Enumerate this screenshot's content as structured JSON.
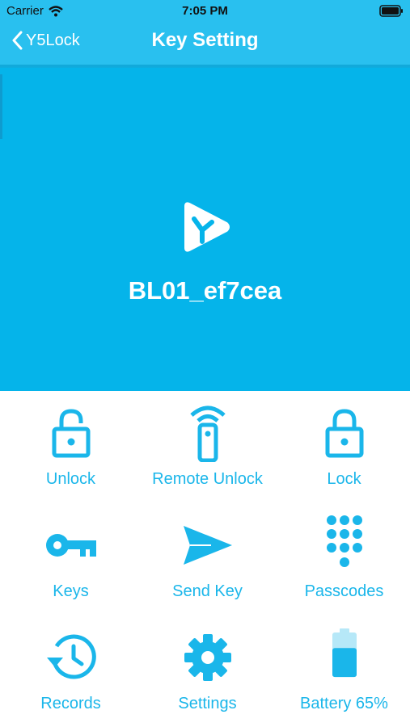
{
  "status_bar": {
    "carrier": "Carrier",
    "time": "7:05 PM"
  },
  "nav": {
    "back_label": "Y5Lock",
    "title": "Key Setting"
  },
  "device": {
    "name": "BL01_ef7cea"
  },
  "actions": [
    {
      "label": "Unlock",
      "icon": "unlock-icon"
    },
    {
      "label": "Remote Unlock",
      "icon": "remote-icon"
    },
    {
      "label": "Lock",
      "icon": "lock-icon"
    },
    {
      "label": "Keys",
      "icon": "key-icon"
    },
    {
      "label": "Send Key",
      "icon": "send-icon"
    },
    {
      "label": "Passcodes",
      "icon": "keypad-icon"
    },
    {
      "label": "Records",
      "icon": "history-icon"
    },
    {
      "label": "Settings",
      "icon": "gear-icon"
    },
    {
      "label": "Battery  65%",
      "icon": "battery-icon",
      "level_percent": 65
    }
  ],
  "colors": {
    "accent": "#1ab6ea",
    "nav_bar": "#29c0ef",
    "hero": "#05b4ea"
  }
}
